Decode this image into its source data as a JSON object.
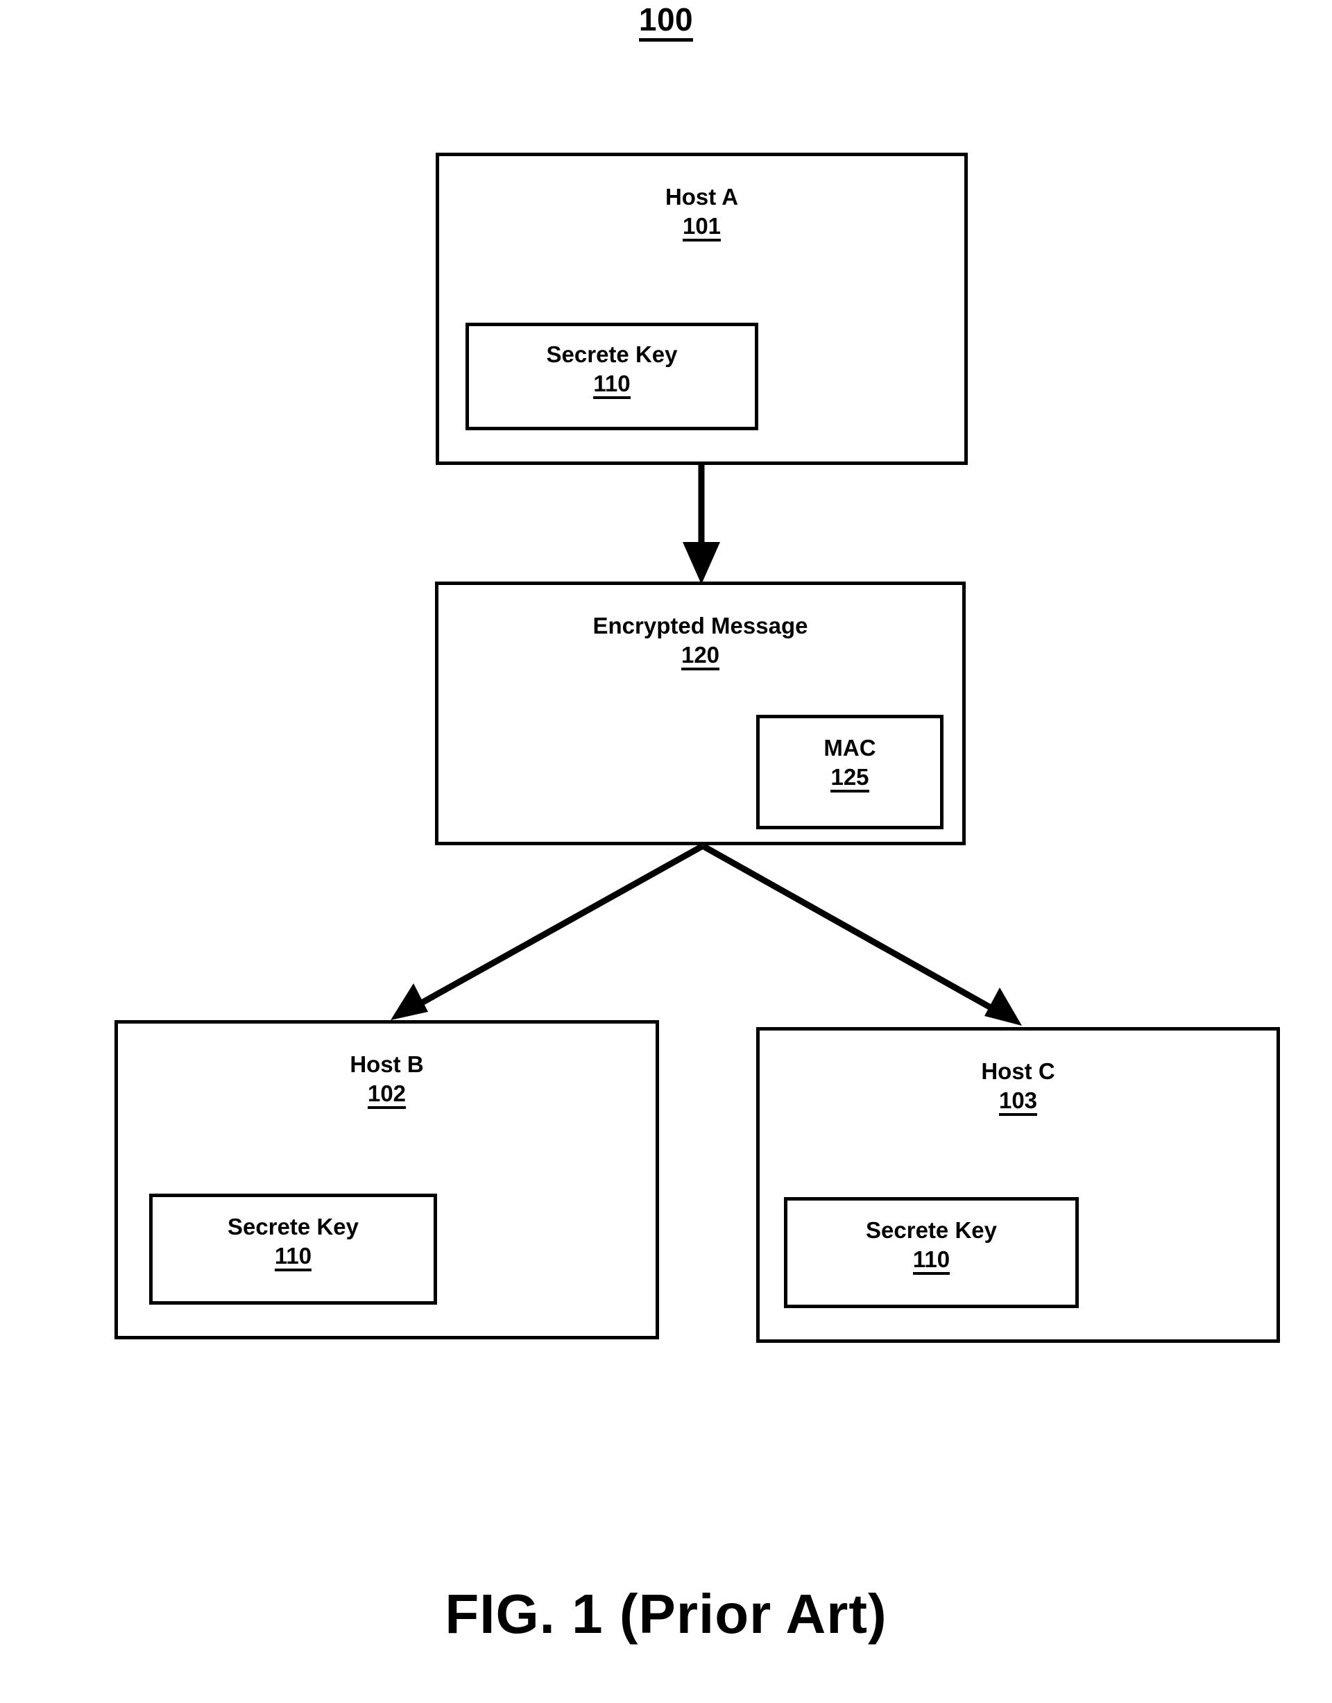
{
  "figure": {
    "reference_number": "100",
    "caption": "FIG. 1 (Prior Art)"
  },
  "nodes": {
    "host_a": {
      "title": "Host A",
      "ref": "101",
      "secret_key": {
        "title": "Secrete Key",
        "ref": "110"
      }
    },
    "encrypted_message": {
      "title": "Encrypted Message",
      "ref": "120",
      "mac": {
        "title": "MAC",
        "ref": "125"
      }
    },
    "host_b": {
      "title": "Host B",
      "ref": "102",
      "secret_key": {
        "title": "Secrete Key",
        "ref": "110"
      }
    },
    "host_c": {
      "title": "Host C",
      "ref": "103",
      "secret_key": {
        "title": "Secrete Key",
        "ref": "110"
      }
    }
  },
  "edges": [
    {
      "name": "host-a-to-encrypted-message",
      "from": "host_a",
      "to": "encrypted_message",
      "label": ""
    },
    {
      "name": "encrypted-message-to-host-b",
      "from": "encrypted_message",
      "to": "host_b",
      "label": ""
    },
    {
      "name": "encrypted-message-to-host-c",
      "from": "encrypted_message",
      "to": "host_c",
      "label": ""
    }
  ],
  "style": {
    "line_color": "#000000",
    "background_color": "#ffffff"
  }
}
